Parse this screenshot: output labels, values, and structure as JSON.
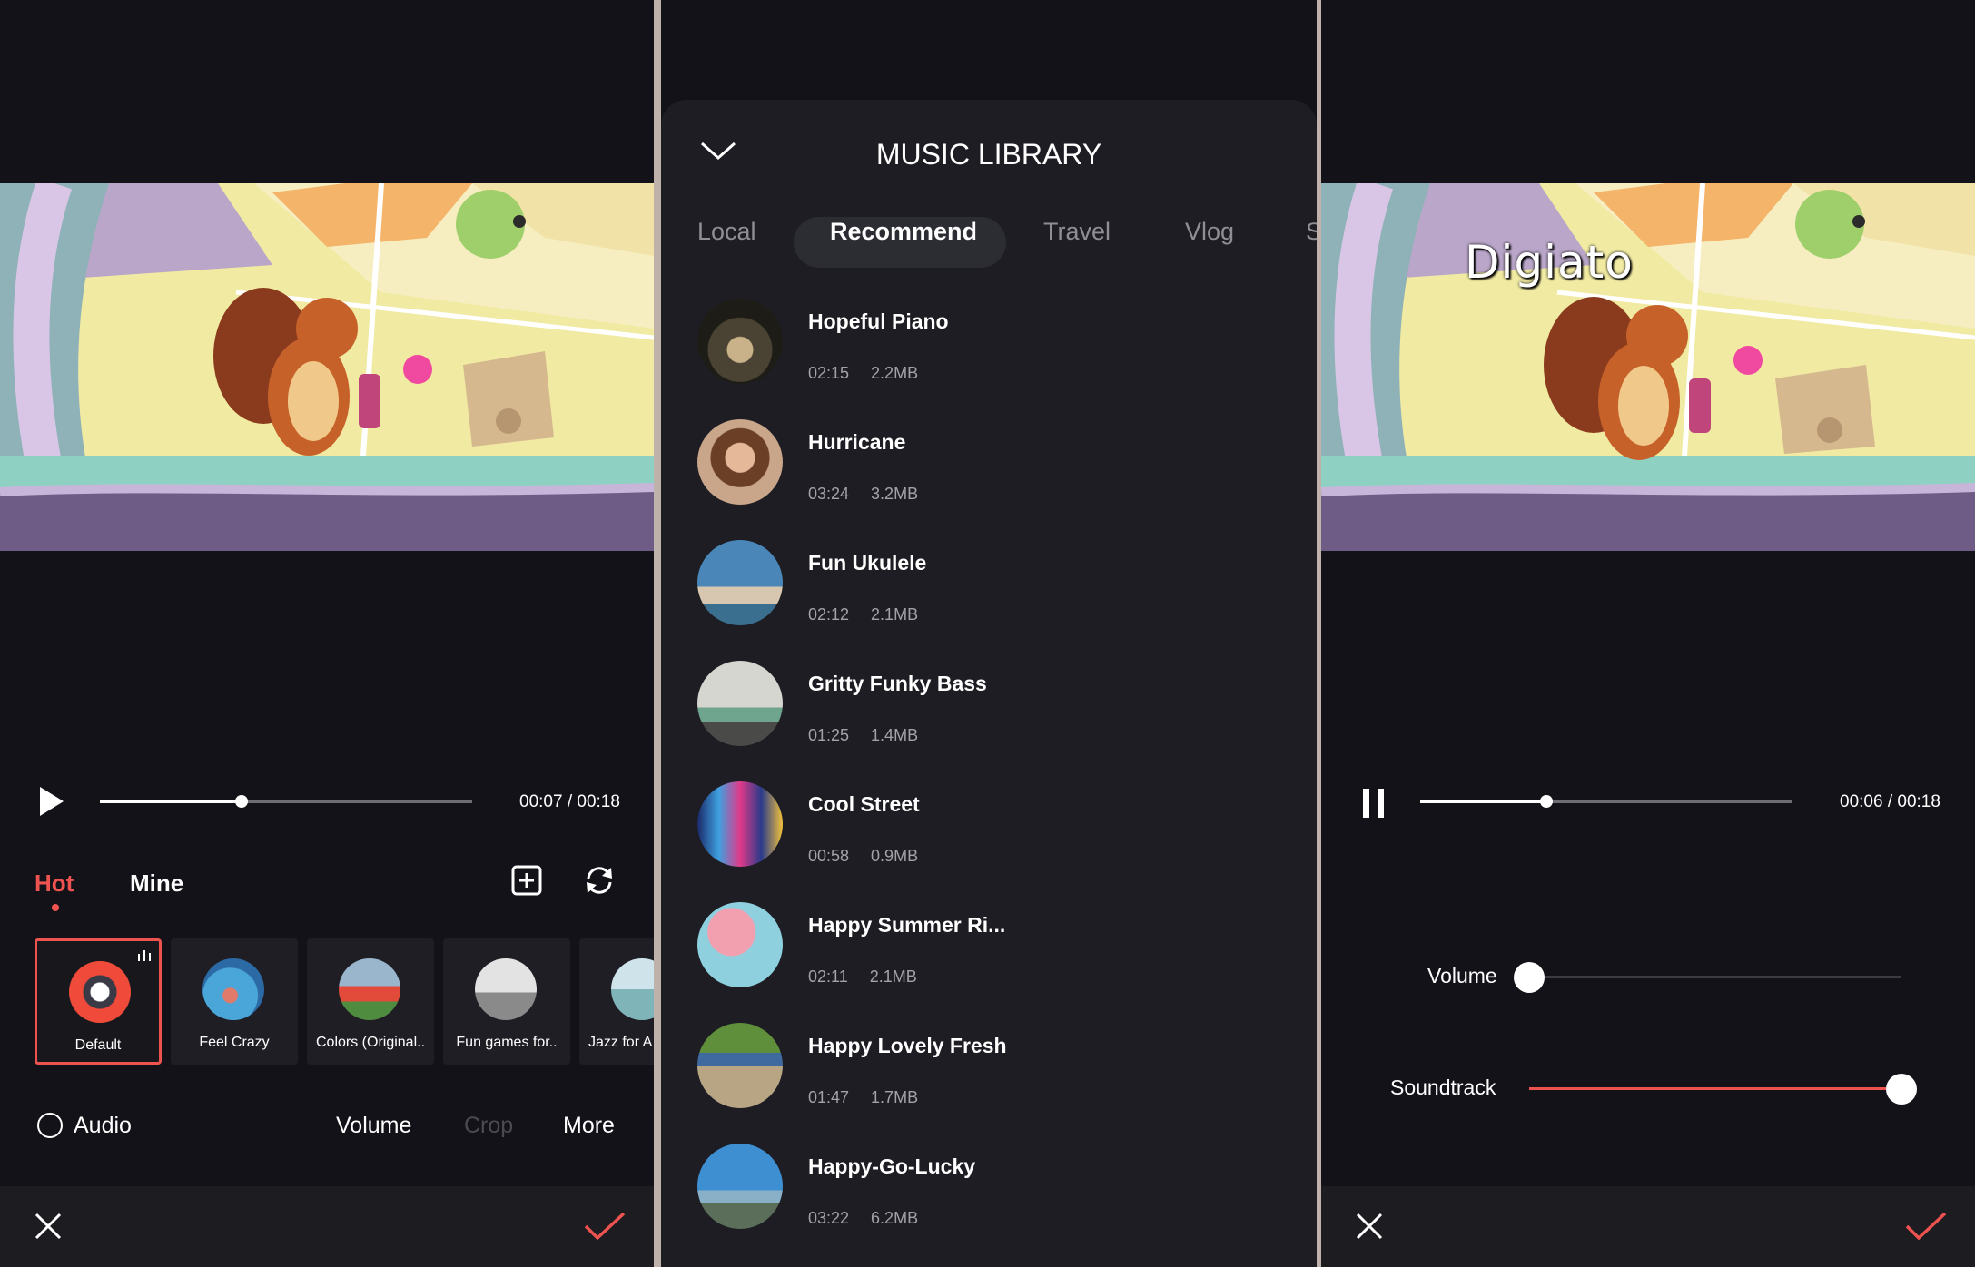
{
  "left": {
    "playback": {
      "time": "00:07 / 00:18",
      "progress": 0.38
    },
    "tabs": {
      "hot": "Hot",
      "mine": "Mine"
    },
    "tracks": [
      {
        "label": "Default",
        "selected": true
      },
      {
        "label": "Feel Crazy"
      },
      {
        "label": "Colors (Original.."
      },
      {
        "label": "Fun games for.."
      },
      {
        "label": "Jazz for A"
      }
    ],
    "bottom": {
      "audio": "Audio",
      "volume": "Volume",
      "crop": "Crop",
      "more": "More"
    }
  },
  "library": {
    "title": "MUSIC LIBRARY",
    "tabs": [
      "Local",
      "Recommend",
      "Travel",
      "Vlog",
      "S"
    ],
    "active_tab": "Recommend",
    "songs": [
      {
        "name": "Hopeful Piano",
        "duration": "02:15",
        "size": "2.2MB"
      },
      {
        "name": "Hurricane",
        "duration": "03:24",
        "size": "3.2MB"
      },
      {
        "name": "Fun Ukulele",
        "duration": "02:12",
        "size": "2.1MB"
      },
      {
        "name": "Gritty Funky Bass",
        "duration": "01:25",
        "size": "1.4MB"
      },
      {
        "name": "Cool Street",
        "duration": "00:58",
        "size": "0.9MB"
      },
      {
        "name": "Happy Summer Ri...",
        "duration": "02:11",
        "size": "2.1MB"
      },
      {
        "name": "Happy Lovely Fresh",
        "duration": "01:47",
        "size": "1.7MB"
      },
      {
        "name": "Happy-Go-Lucky",
        "duration": "03:22",
        "size": "6.2MB"
      }
    ]
  },
  "right": {
    "watermark": "Digiato",
    "playback": {
      "time": "00:06 / 00:18",
      "progress": 0.34
    },
    "volume": {
      "label": "Volume",
      "level": 0.0
    },
    "soundtrack": {
      "label": "Soundtrack",
      "level": 1.0
    }
  },
  "colors": {
    "accent": "#ef5350",
    "background": "#121218",
    "sheet": "#1d1d23"
  }
}
